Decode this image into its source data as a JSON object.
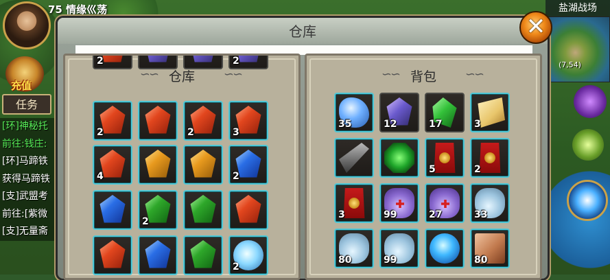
{
  "hud": {
    "level_name": "75 情缘巛荡",
    "recharge_label": "充值",
    "task_button": "任务",
    "quests": [
      {
        "text": "[环]神秘托",
        "color": "green"
      },
      {
        "text": "前往:钱庄:",
        "color": "green"
      },
      {
        "text": "[环]马蹄铁",
        "color": "white"
      },
      {
        "text": "获得马蹄铁",
        "color": "white"
      },
      {
        "text": "[支]武盟考",
        "color": "white"
      },
      {
        "text": "前往:[紫微",
        "color": "white"
      },
      {
        "text": "[支]无量斋",
        "color": "white"
      }
    ]
  },
  "minimap": {
    "area_name": "盐湖战场",
    "coords": "(7,54)"
  },
  "window": {
    "title": "仓库",
    "close_icon": "✕"
  },
  "warehouse": {
    "title": "仓库",
    "top_partial_qty": [
      "2",
      "",
      "",
      "2"
    ],
    "rows": [
      [
        {
          "icon": "gem-red",
          "qty": "2"
        },
        {
          "icon": "gem-red",
          "qty": ""
        },
        {
          "icon": "gem-red",
          "qty": "2"
        },
        {
          "icon": "gem-red",
          "qty": "3"
        }
      ],
      [
        {
          "icon": "gem-red",
          "qty": "4"
        },
        {
          "icon": "gem-orange",
          "qty": ""
        },
        {
          "icon": "gem-orange",
          "qty": ""
        },
        {
          "icon": "gem-blue",
          "qty": "2"
        }
      ],
      [
        {
          "icon": "gem-blue",
          "qty": ""
        },
        {
          "icon": "gem-green",
          "qty": "2"
        },
        {
          "icon": "gem-green",
          "qty": ""
        },
        {
          "icon": "gem-red",
          "qty": ""
        }
      ],
      [
        {
          "icon": "gem-red",
          "qty": ""
        },
        {
          "icon": "gem-blue",
          "qty": ""
        },
        {
          "icon": "gem-green",
          "qty": ""
        },
        {
          "icon": "glove",
          "qty": "2"
        }
      ]
    ]
  },
  "backpack": {
    "title": "背包",
    "rows": [
      [
        {
          "icon": "crystal-blue",
          "qty": "35"
        },
        {
          "icon": "gem-purple",
          "qty": "12"
        },
        {
          "icon": "shard-green",
          "qty": "17"
        },
        {
          "icon": "scroll-paper",
          "qty": "3"
        }
      ],
      [
        {
          "icon": "iron-bar",
          "qty": ""
        },
        {
          "icon": "green-gem-box",
          "qty": ""
        },
        {
          "icon": "red-scroll",
          "qty": "5"
        },
        {
          "icon": "red-scroll",
          "qty": "2"
        }
      ],
      [
        {
          "icon": "red-scroll",
          "qty": "3"
        },
        {
          "icon": "jar",
          "qty": "99"
        },
        {
          "icon": "jar",
          "qty": "27"
        },
        {
          "icon": "bottle",
          "qty": "33"
        }
      ],
      [
        {
          "icon": "bottle",
          "qty": "80"
        },
        {
          "icon": "bottle",
          "qty": "99"
        },
        {
          "icon": "orb",
          "qty": ""
        },
        {
          "icon": "book",
          "qty": "80"
        }
      ]
    ]
  },
  "colors": {
    "slot_frame": "#4fc7d6",
    "quest_green": "#58ee58",
    "close_button": "#f08a1a"
  }
}
